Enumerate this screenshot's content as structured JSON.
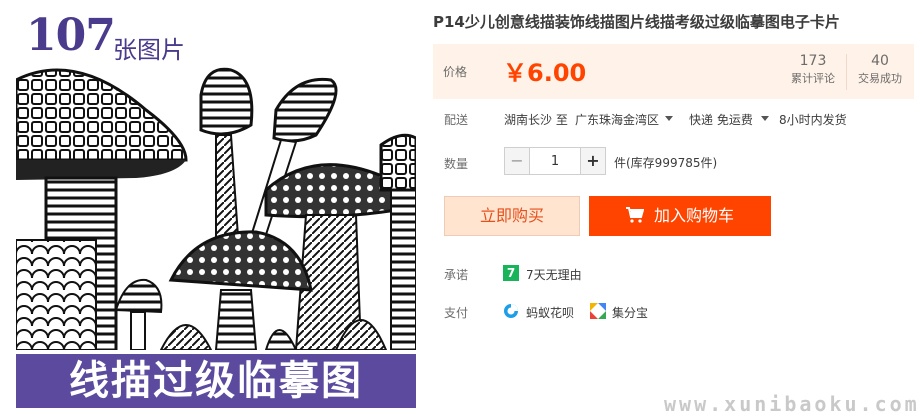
{
  "product_image": {
    "count_number": "107",
    "count_unit": "张图片",
    "banner_text": "线描过级临摹图"
  },
  "product": {
    "title": "P14少儿创意线描装饰线描图片线描考级过级临摹图电子卡片"
  },
  "price": {
    "label": "价格",
    "value": "￥6.00",
    "reviews_count": "173",
    "reviews_label": "累计评论",
    "sales_count": "40",
    "sales_label": "交易成功"
  },
  "shipping": {
    "label": "配送",
    "from": "湖南长沙 至",
    "to": "广东珠海金湾区",
    "method": "快递 免运费",
    "dispatch": "8小时内发货"
  },
  "quantity": {
    "label": "数量",
    "minus": "−",
    "value": "1",
    "plus": "+",
    "stock": "件(库存999785件)"
  },
  "actions": {
    "buy_now": "立即购买",
    "add_to_cart": "加入购物车"
  },
  "promise": {
    "label": "承诺",
    "icon_text": "7",
    "text": "7天无理由"
  },
  "payment": {
    "label": "支付",
    "methods": [
      {
        "icon": "huabei-icon",
        "name": "蚂蚁花呗"
      },
      {
        "icon": "jifenbao-icon",
        "name": "集分宝"
      }
    ]
  },
  "watermark": "www.xunibaoku.com",
  "colors": {
    "accent": "#ff4400",
    "price_bg": "#fff2e8",
    "banner": "#5b4a9e",
    "brand_text": "#4b3b8c"
  }
}
